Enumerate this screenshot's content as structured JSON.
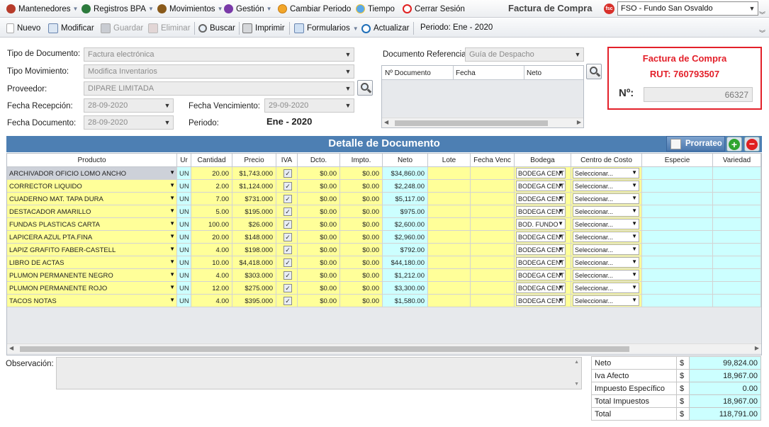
{
  "menubar": {
    "items": [
      {
        "label": "Mantenedores",
        "icon": "wrench-gear-icon"
      },
      {
        "label": "Registros BPA",
        "icon": "records-icon"
      },
      {
        "label": "Movimientos",
        "icon": "arrows-icon"
      },
      {
        "label": "Gestión",
        "icon": "management-icon"
      }
    ],
    "cambiar_periodo": "Cambiar Periodo",
    "tiempo": "Tiempo",
    "cerrar_sesion": "Cerrar Sesión",
    "title": "Factura de Compra",
    "fund_select": "FSO - Fundo San Osvaldo",
    "fund_logo": "fsc"
  },
  "toolbar": {
    "nuevo": "Nuevo",
    "modificar": "Modificar",
    "guardar": "Guardar",
    "eliminar": "Eliminar",
    "buscar": "Buscar",
    "imprimir": "Imprimir",
    "formularios": "Formularios",
    "actualizar": "Actualizar",
    "periodo": "Periodo: Ene - 2020"
  },
  "form": {
    "tipo_documento_label": "Tipo de Documento:",
    "tipo_documento_value": "Factura electrónica",
    "tipo_movimiento_label": "Tipo Movimiento:",
    "tipo_movimiento_value": "Modifica Inventarios",
    "proveedor_label": "Proveedor:",
    "proveedor_value": "DIPARE LIMITADA",
    "fecha_recepcion_label": "Fecha Recepción:",
    "fecha_recepcion_value": "28-09-2020",
    "fecha_vencimiento_label": "Fecha Vencimiento:",
    "fecha_vencimiento_value": "29-09-2020",
    "fecha_documento_label": "Fecha Documento:",
    "fecha_documento_value": "28-09-2020",
    "periodo_label": "Periodo:",
    "periodo_value": "Ene - 2020",
    "doc_ref_label": "Documento Referencia:",
    "doc_ref_value": "Guía de Despacho",
    "ref_columns": [
      "Nº Documento",
      "Fecha",
      "Neto"
    ]
  },
  "header_box": {
    "title": "Factura de Compra",
    "rut": "RUT: 760793507",
    "numero_label": "Nº:",
    "numero_value": "66327"
  },
  "detail": {
    "title": "Detalle de Documento",
    "prorrateo": "Prorrateo",
    "columns": [
      "Producto",
      "Ur",
      "Cantidad",
      "Precio",
      "IVA",
      "Dcto.",
      "Impto.",
      "Neto",
      "Lote",
      "Fecha Venc",
      "Bodega",
      "Centro de Costo",
      "Especie",
      "Variedad"
    ],
    "rows": [
      {
        "producto": "ARCHIVADOR OFICIO LOMO ANCHO",
        "um": "UN",
        "cantidad": "20.00",
        "precio": "$1,743.000",
        "iva": "✓",
        "dcto": "$0.00",
        "impto": "$0.00",
        "neto": "$34,860.00",
        "bodega": "BODEGA CENT",
        "centro": "Seleccionar..."
      },
      {
        "producto": "CORRECTOR LIQUIDO",
        "um": "UN",
        "cantidad": "2.00",
        "precio": "$1,124.000",
        "iva": "✓",
        "dcto": "$0.00",
        "impto": "$0.00",
        "neto": "$2,248.00",
        "bodega": "BODEGA CENT",
        "centro": "Seleccionar..."
      },
      {
        "producto": "CUADERNO MAT. TAPA DURA",
        "um": "UN",
        "cantidad": "7.00",
        "precio": "$731.000",
        "iva": "✓",
        "dcto": "$0.00",
        "impto": "$0.00",
        "neto": "$5,117.00",
        "bodega": "BODEGA CENT",
        "centro": "Seleccionar..."
      },
      {
        "producto": "DESTACADOR AMARILLO",
        "um": "UN",
        "cantidad": "5.00",
        "precio": "$195.000",
        "iva": "✓",
        "dcto": "$0.00",
        "impto": "$0.00",
        "neto": "$975.00",
        "bodega": "BODEGA CENT",
        "centro": "Seleccionar..."
      },
      {
        "producto": "FUNDAS PLASTICAS CARTA",
        "um": "UN",
        "cantidad": "100.00",
        "precio": "$26.000",
        "iva": "✓",
        "dcto": "$0.00",
        "impto": "$0.00",
        "neto": "$2,600.00",
        "bodega": "BOD. FUNDO",
        "centro": "Seleccionar..."
      },
      {
        "producto": "LAPICERA AZUL PTA.FINA",
        "um": "UN",
        "cantidad": "20.00",
        "precio": "$148.000",
        "iva": "✓",
        "dcto": "$0.00",
        "impto": "$0.00",
        "neto": "$2,960.00",
        "bodega": "BODEGA CENT",
        "centro": "Seleccionar..."
      },
      {
        "producto": "LAPIZ GRAFITO FABER-CASTELL",
        "um": "UN",
        "cantidad": "4.00",
        "precio": "$198.000",
        "iva": "✓",
        "dcto": "$0.00",
        "impto": "$0.00",
        "neto": "$792.00",
        "bodega": "BODEGA CENT",
        "centro": "Seleccionar..."
      },
      {
        "producto": "LIBRO DE ACTAS",
        "um": "UN",
        "cantidad": "10.00",
        "precio": "$4,418.000",
        "iva": "✓",
        "dcto": "$0.00",
        "impto": "$0.00",
        "neto": "$44,180.00",
        "bodega": "BODEGA CENT",
        "centro": "Seleccionar..."
      },
      {
        "producto": "PLUMON PERMANENTE NEGRO",
        "um": "UN",
        "cantidad": "4.00",
        "precio": "$303.000",
        "iva": "✓",
        "dcto": "$0.00",
        "impto": "$0.00",
        "neto": "$1,212.00",
        "bodega": "BODEGA CENT",
        "centro": "Seleccionar..."
      },
      {
        "producto": "PLUMON PERMANENTE ROJO",
        "um": "UN",
        "cantidad": "12.00",
        "precio": "$275.000",
        "iva": "✓",
        "dcto": "$0.00",
        "impto": "$0.00",
        "neto": "$3,300.00",
        "bodega": "BODEGA CENT",
        "centro": "Seleccionar..."
      },
      {
        "producto": "TACOS NOTAS",
        "um": "UN",
        "cantidad": "4.00",
        "precio": "$395.000",
        "iva": "✓",
        "dcto": "$0.00",
        "impto": "$0.00",
        "neto": "$1,580.00",
        "bodega": "BODEGA CENT",
        "centro": "Seleccionar..."
      }
    ]
  },
  "observacion_label": "Observación:",
  "totals": [
    {
      "label": "Neto",
      "currency": "$",
      "value": "99,824.00"
    },
    {
      "label": "Iva Afecto",
      "currency": "$",
      "value": "18,967.00"
    },
    {
      "label": "Impuesto Específico",
      "currency": "$",
      "value": "0.00"
    },
    {
      "label": "Total Impuestos",
      "currency": "$",
      "value": "18,967.00"
    },
    {
      "label": "Total",
      "currency": "$",
      "value": "118,791.00"
    }
  ],
  "colors": {
    "accent_blue": "#4d7fb3",
    "red": "#e3202a",
    "yellow_cell": "#ffff99",
    "cyan_cell": "#ccffff"
  }
}
